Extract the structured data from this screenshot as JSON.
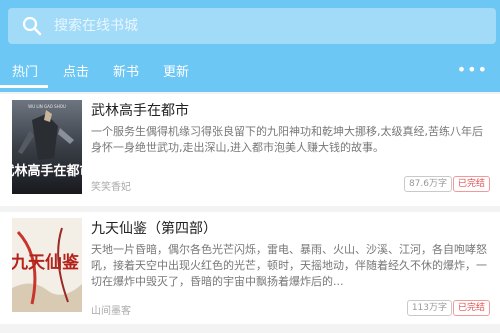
{
  "search": {
    "placeholder": "搜索在线书城"
  },
  "tabs": [
    {
      "label": "热门",
      "active": true
    },
    {
      "label": "点击"
    },
    {
      "label": "新书"
    },
    {
      "label": "更新"
    }
  ],
  "more": "•••",
  "books": [
    {
      "title": "武林高手在都市",
      "description": "一个服务生偶得机缘习得张良留下的九阳神功和乾坤大挪移,太级真经,苦练八年后身怀一身绝世武功,走出深山,进入都市泡美人赚大钱的故事。",
      "author": "笑笑香妃",
      "word_count": "87.6万字",
      "status": "已完结",
      "cover_text": "武林高手在都市",
      "cover_top_text": "WU LIN GAO SHOU"
    },
    {
      "title": "九天仙鉴（第四部）",
      "description": "天地一片昏暗，偶尔各色光芒闪烁，雷电、暴雨、火山、沙溪、江河，各自咆哮怒吼，接着天空中出现火红色的光芒，顿时，天摇地动，伴随着经久不休的爆炸，一切在爆炸中毁灭了，昏暗的宇宙中飘扬着爆炸后的...",
      "author": "山间墨客",
      "word_count": "113万字",
      "status": "已完结",
      "cover_text": "九天仙鉴"
    }
  ],
  "colors": {
    "header": "#6cc7f5",
    "search_bg": "#a1dbf8",
    "status_red": "#e04e4e"
  }
}
